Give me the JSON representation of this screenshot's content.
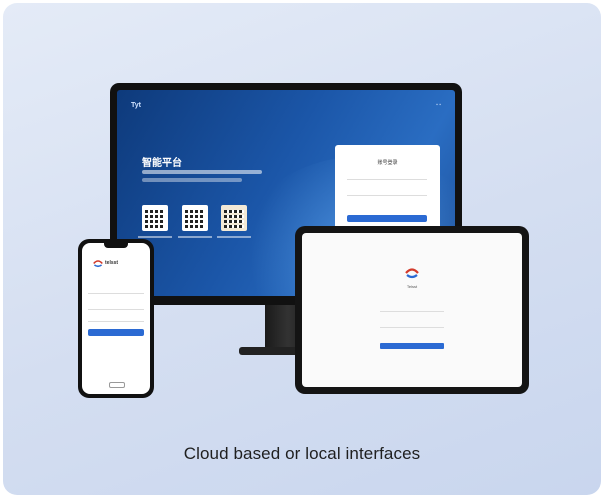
{
  "caption": "Cloud based or local interfaces",
  "devices": {
    "monitor": {
      "brand": "Tyt",
      "title": "智能平台",
      "login_title": "账号登录"
    },
    "phone": {
      "brand": "telsst"
    },
    "tablet": {
      "brand": "Telsst"
    }
  },
  "colors": {
    "card_bg": "#d4def1",
    "screen_blue": "#1b56a8",
    "accent": "#2b6ad3"
  }
}
